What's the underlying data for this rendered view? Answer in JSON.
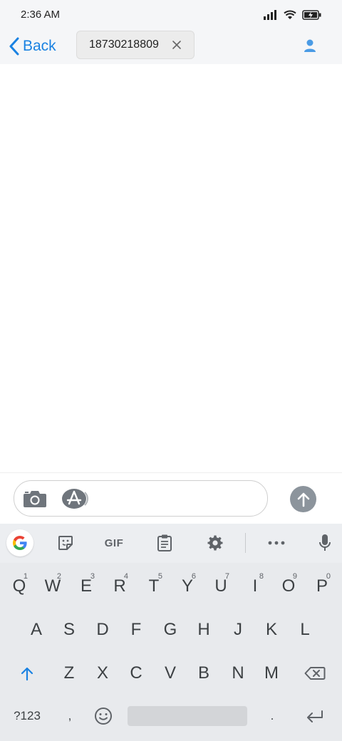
{
  "status_bar": {
    "time": "2:36 AM",
    "icons": [
      "signal-icon",
      "wifi-icon",
      "battery-charging-icon"
    ]
  },
  "nav": {
    "back_label": "Back",
    "recipient": "18730218809",
    "icons": [
      "chevron-left-icon",
      "clear-icon",
      "contact-icon"
    ]
  },
  "composer": {
    "icons": [
      "camera-icon",
      "app-store-icon",
      "send-arrow-icon"
    ]
  },
  "keyboard": {
    "toolbar": {
      "gif_label": "GIF",
      "icons": [
        "google-icon",
        "sticker-icon",
        "clipboard-icon",
        "settings-icon",
        "more-icon",
        "microphone-icon"
      ]
    },
    "row1": [
      {
        "key": "Q",
        "hint": "1"
      },
      {
        "key": "W",
        "hint": "2"
      },
      {
        "key": "E",
        "hint": "3"
      },
      {
        "key": "R",
        "hint": "4"
      },
      {
        "key": "T",
        "hint": "5"
      },
      {
        "key": "Y",
        "hint": "6"
      },
      {
        "key": "U",
        "hint": "7"
      },
      {
        "key": "I",
        "hint": "8"
      },
      {
        "key": "O",
        "hint": "9"
      },
      {
        "key": "P",
        "hint": "0"
      }
    ],
    "row2": [
      "A",
      "S",
      "D",
      "F",
      "G",
      "H",
      "J",
      "K",
      "L"
    ],
    "row3": [
      "Z",
      "X",
      "C",
      "V",
      "B",
      "N",
      "M"
    ],
    "bottom": {
      "symbols": "?123",
      "comma": ",",
      "period": "."
    },
    "accent_color": "#1a82e2"
  },
  "colors": {
    "accent": "#1a82e2",
    "send_button": "#8c949c",
    "keyboard_bg": "#e8eaed"
  }
}
